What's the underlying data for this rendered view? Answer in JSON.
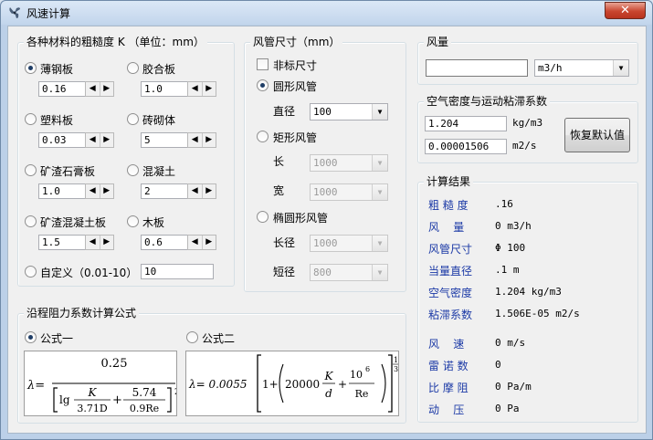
{
  "window": {
    "title": "风速计算",
    "close_label": "✕"
  },
  "roughness": {
    "legend": "各种材料的粗糙度 K  （单位：mm）",
    "materials": [
      {
        "label": "薄钢板",
        "value": "0.16",
        "selected": true
      },
      {
        "label": "胶合板",
        "value": "1.0",
        "selected": false
      },
      {
        "label": "塑料板",
        "value": "0.03",
        "selected": false
      },
      {
        "label": "砖砌体",
        "value": "5",
        "selected": false
      },
      {
        "label": "矿渣石膏板",
        "value": "1.0",
        "selected": false
      },
      {
        "label": "混凝土",
        "value": "2",
        "selected": false
      },
      {
        "label": "矿渣混凝土板",
        "value": "1.5",
        "selected": false
      },
      {
        "label": "木板",
        "value": "0.6",
        "selected": false
      }
    ],
    "custom": {
      "label": "自定义（0.01-10）",
      "value": "10",
      "selected": false
    }
  },
  "duct": {
    "legend": "风管尺寸（mm）",
    "nonstandard_label": "非标尺寸",
    "round_label": "圆形风管",
    "diameter_label": "直径",
    "diameter_value": "100",
    "rect_label": "矩形风管",
    "length_label": "长",
    "length_value": "1000",
    "width_label": "宽",
    "width_value": "1000",
    "oval_label": "椭圆形风管",
    "major_label": "长径",
    "major_value": "1000",
    "minor_label": "短径",
    "minor_value": "800"
  },
  "airflow": {
    "legend": "风量",
    "value": "",
    "unit": "m3/h"
  },
  "air_props": {
    "legend": "空气密度与运动粘滞系数",
    "density": "1.204",
    "density_unit": "kg/m3",
    "viscosity": "0.00001506",
    "viscosity_unit": "m2/s",
    "reset_label": "恢复默认值"
  },
  "results": {
    "legend": "计算结果",
    "rows": [
      {
        "label": "粗 糙 度",
        "value": ".16"
      },
      {
        "label": "风    量",
        "value": "0 m3/h"
      },
      {
        "label": "风管尺寸",
        "value": "Φ 100"
      },
      {
        "label": "当量直径",
        "value": ".1 m"
      },
      {
        "label": "空气密度",
        "value": "1.204 kg/m3"
      },
      {
        "label": "粘滞系数",
        "value": "1.506E-05 m2/s"
      },
      {
        "label": "风    速",
        "value": "0 m/s"
      },
      {
        "label": "雷 诺 数",
        "value": "0"
      },
      {
        "label": "比 摩 阻",
        "value": "0 Pa/m"
      },
      {
        "label": "动    压",
        "value": "0 Pa"
      }
    ]
  },
  "friction": {
    "legend": "沿程阻力系数计算公式",
    "formula1_label": "公式一",
    "formula2_label": "公式二",
    "selected": "formula1",
    "f1": {
      "lambda": "λ=",
      "num": "0.25",
      "lg": "lg",
      "k": "K",
      "d1": "3.71D",
      "plus": "+",
      "n2": "5.74",
      "d2": "0.9Re",
      "exp": "2"
    },
    "f2": {
      "lead": "λ= 0.0055",
      "one": "1+",
      "c": "20000",
      "k": "K",
      "d": "d",
      "plus": "+",
      "n": "10",
      "nexp": "6",
      "re": "Re",
      "exp_n": "1",
      "exp_d": "3"
    }
  }
}
